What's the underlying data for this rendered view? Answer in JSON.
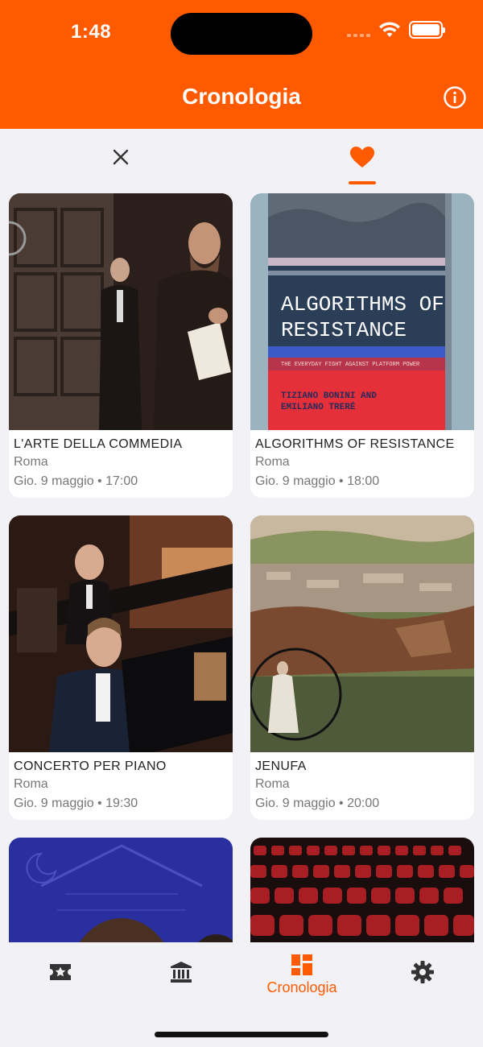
{
  "status_bar": {
    "time": "1:48"
  },
  "header": {
    "title": "Cronologia"
  },
  "filter_tabs": {
    "close_icon": "close-icon",
    "favorite_icon": "heart-icon",
    "active": "favorites"
  },
  "events": [
    {
      "title": "L'ARTE DELLA COMMEDIA",
      "city": "Roma",
      "date": "Gio.  9 maggio • 17:00",
      "image": "theatre-actors-photo"
    },
    {
      "title": "ALGORITHMS OF RESISTANCE",
      "city": "Roma",
      "date": "Gio.  9 maggio • 18:00",
      "image": "book-cover",
      "cover": {
        "title_line1": "ALGORITHMS OF",
        "title_line2": "RESISTANCE",
        "subtitle": "THE EVERYDAY FIGHT AGAINST PLATFORM POWER",
        "authors_line1": "TIZIANO BONINI AND",
        "authors_line2": "EMILIANO TRERÉ"
      }
    },
    {
      "title": "CONCERTO PER PIANO",
      "city": "Roma",
      "date": "Gio.  9 maggio • 19:30",
      "image": "pianist-orchestra-photo"
    },
    {
      "title": "JENUFA",
      "city": "Roma",
      "date": "Gio.  9 maggio • 20:00",
      "image": "painted-landscape-collage"
    },
    {
      "title": "",
      "city": "",
      "date": "",
      "image": "woman-portrait-blue-poster"
    },
    {
      "title": "",
      "city": "",
      "date": "",
      "image": "red-theatre-seats-photo"
    }
  ],
  "bottom_nav": [
    {
      "icon": "ticket-star-icon",
      "label": ""
    },
    {
      "icon": "museum-icon",
      "label": ""
    },
    {
      "icon": "history-grid-icon",
      "label": "Cronologia",
      "active": true
    },
    {
      "icon": "gear-icon",
      "label": ""
    }
  ],
  "colors": {
    "accent": "#ff5a00",
    "background": "#f2f2f6",
    "inactive_icon": "#333333"
  }
}
